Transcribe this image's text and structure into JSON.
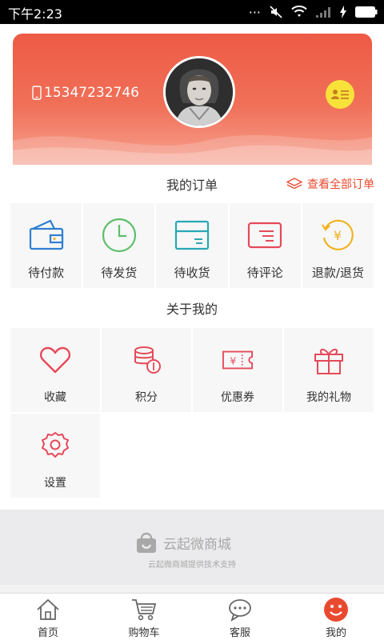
{
  "status_bar": {
    "time": "下午2:23"
  },
  "profile": {
    "phone": "15347232746"
  },
  "orders": {
    "title": "我的订单",
    "view_all": "查看全部订单",
    "items": [
      {
        "label": "待付款",
        "icon": "wallet-icon"
      },
      {
        "label": "待发货",
        "icon": "clock-icon"
      },
      {
        "label": "待收货",
        "icon": "inbox-icon"
      },
      {
        "label": "待评论",
        "icon": "comment-icon"
      },
      {
        "label": "退款/退货",
        "icon": "refund-icon"
      }
    ]
  },
  "about": {
    "title": "关于我的",
    "items": [
      {
        "label": "收藏",
        "icon": "heart-icon"
      },
      {
        "label": "积分",
        "icon": "coins-icon"
      },
      {
        "label": "优惠券",
        "icon": "coupon-icon"
      },
      {
        "label": "我的礼物",
        "icon": "gift-icon"
      },
      {
        "label": "设置",
        "icon": "settings-icon"
      }
    ]
  },
  "brand": {
    "name": "云起微商城",
    "tagline": "云起微商城提供技术支持"
  },
  "tabbar": {
    "items": [
      {
        "label": "首页",
        "icon": "home-icon"
      },
      {
        "label": "购物车",
        "icon": "cart-icon"
      },
      {
        "label": "客服",
        "icon": "chat-icon"
      },
      {
        "label": "我的",
        "icon": "smiley-icon",
        "active": true
      }
    ]
  },
  "colors": {
    "accent": "#e94a2f",
    "card_gradient_top": "#ee5a45",
    "card_gradient_bottom": "#f7a290",
    "icon_red": "#e54a5a",
    "icon_teal": "#2aa7b4",
    "icon_green": "#5cbf6a",
    "icon_blue": "#2f7fd1",
    "icon_yellow": "#f0b21e"
  }
}
